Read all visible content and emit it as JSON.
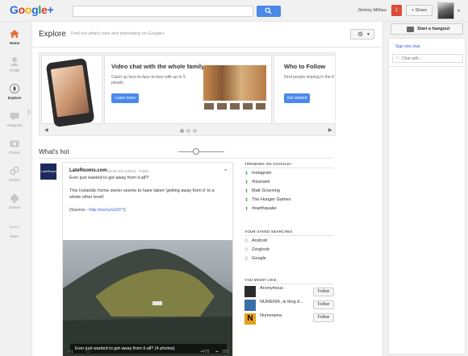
{
  "header": {
    "logo_text": "Google+",
    "username": "Jérémy Milhau",
    "notification_count": "1",
    "share_label": "+ Share"
  },
  "leftnav": {
    "items": [
      {
        "label": "Home",
        "icon": "home-icon"
      },
      {
        "label": "Profile",
        "icon": "profile-icon"
      },
      {
        "label": "Explore",
        "icon": "explore-icon",
        "active": true
      },
      {
        "label": "Hangouts",
        "icon": "hangout-icon"
      },
      {
        "label": "Photos",
        "icon": "photos-icon"
      },
      {
        "label": "Circles",
        "icon": "circles-icon"
      },
      {
        "label": "Games",
        "icon": "games-icon"
      },
      {
        "label": "More",
        "icon": "more-icon"
      }
    ]
  },
  "explore": {
    "title": "Explore",
    "subtitle": "Find out what's new and interesting on Google+"
  },
  "carousel": {
    "cards": [
      {
        "title": "Video chat with the whole family",
        "text": "Catch up face-to-face-to-face with up to 9 people",
        "button": "Learn more"
      },
      {
        "title": "Who to Follow",
        "text": "Find people sharing in the things you care about",
        "button": "Get started"
      }
    ]
  },
  "whats_hot": {
    "title": "What's hot"
  },
  "post": {
    "avatar_text": "LateRooms.com",
    "author": "LateRooms.com",
    "meta": "10:30 AM (edited) - Public",
    "line1": "Ever just wanted to get away from it all?!",
    "line2": "This Icelandic home owner seems to have taken 'getting away from it' to a",
    "line3": "whole other level!",
    "source_prefix": "(Source - ",
    "source_link": "http://ow.ly/a19YT",
    "source_suffix": ")",
    "caption": "Ever just wanted to get away from it all? (4 photos)",
    "plus_count": "+1",
    "plus_total": "+478",
    "share_count": "291"
  },
  "trending": {
    "title": "TRENDING ON GOOGLE+",
    "items": [
      "Instagram",
      "#tsunami",
      "Matt Groening",
      "The Hunger Games",
      "#earthquake"
    ]
  },
  "saved_searches": {
    "title": "YOUR SAVED SEARCHES",
    "items": [
      "Android",
      "Zorgloob",
      "Google"
    ]
  },
  "you_might_like": {
    "title": "YOU MIGHT LIKE",
    "follow_label": "Follow",
    "items": [
      {
        "name": "Anonymous",
        "color": "#2b2b2b"
      },
      {
        "name": "NUMERIK, le blog d...",
        "color": "#3a6ea5"
      },
      {
        "name": "Numerama",
        "color": "#e4a11b"
      }
    ]
  },
  "rightpanel": {
    "hangout_label": "Start a hangout",
    "signin_chat": "Sign into chat",
    "chat_placeholder": "Chat with..."
  },
  "colors": {
    "accent_blue": "#4a88ec",
    "notification_red": "#dd4b39",
    "trend_green": "#56b068"
  }
}
